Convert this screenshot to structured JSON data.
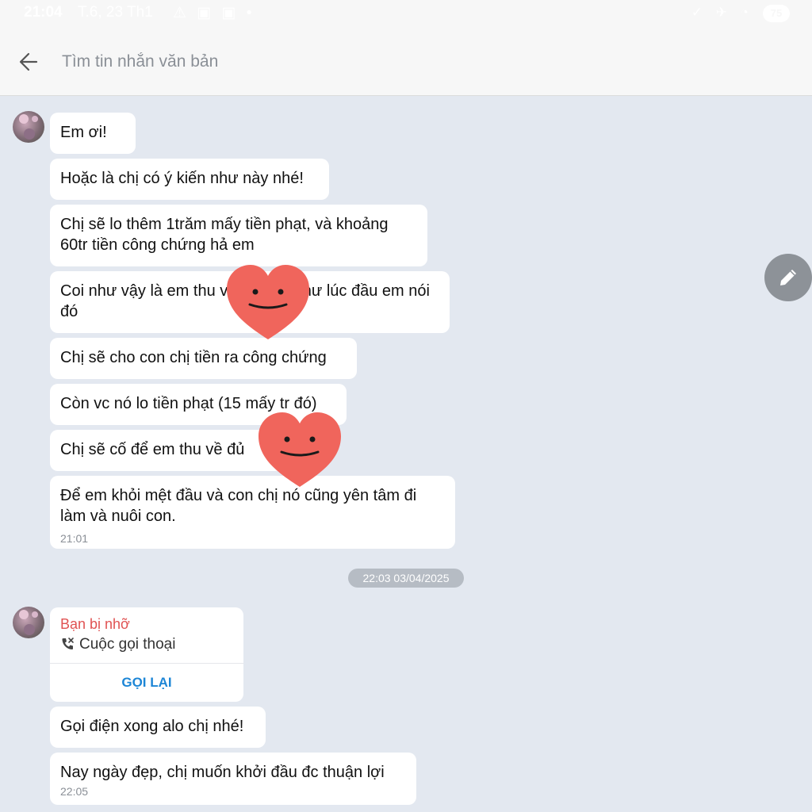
{
  "status_bar": {
    "time": "21:04",
    "date": "T.6, 23 Th1",
    "battery": "75"
  },
  "header": {
    "back_icon": "arrow-left-icon",
    "search_placeholder": "Tìm tin nhắn văn bản"
  },
  "messages_group1": [
    "Em ơi!",
    "Hoặc là chị có ý kiến như này nhé!",
    "Chị sẽ lo thêm 1trăm mấy tiền phạt, và khoảng 60tr tiền công chứng hả em",
    "Coi như vậy là em thu về đủ nhà như lúc đầu em nói đó",
    "Chị sẽ cho con chị tiền ra công chứng",
    "Còn vc nó lo tiền phạt (15 mấy tr đó)",
    "Chị sẽ cố để em thu về đủ",
    "Để em khỏi mệt đầu và con chị nó cũng yên tâm đi làm và nuôi con."
  ],
  "group1_time": "21:01",
  "date_divider": "22:03 03/04/2025",
  "missed_call": {
    "title": "Bạn bị nhỡ",
    "type": "Cuộc gọi thoại",
    "callback": "GỌI LẠI",
    "title_color": "#e05353",
    "action_color": "#1d86d6"
  },
  "messages_group2": [
    "Gọi điện xong alo chị nhé!",
    "Nay ngày đẹp, chị muốn khởi đầu đc thuận lợi"
  ],
  "group2_time": "22:05",
  "colors": {
    "chat_background": "#e3e8f0",
    "bubble": "#ffffff",
    "sticker_heart": "#f0655c"
  },
  "icons": {
    "edit": "pencil-icon",
    "missed_call": "missed-call-icon",
    "sticker": "heart-smiley-sticker"
  }
}
